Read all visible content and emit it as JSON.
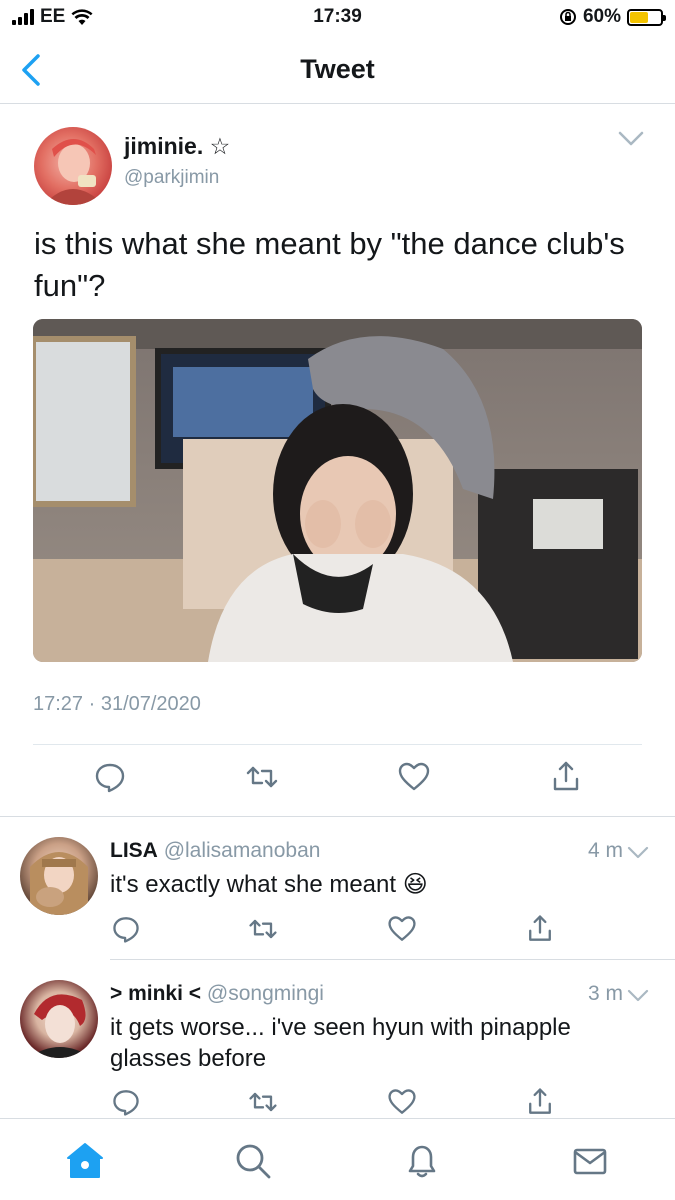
{
  "status_bar": {
    "carrier": "EE",
    "time": "17:39",
    "battery_percent": "60%",
    "battery_level": 0.6,
    "battery_color": "#f3c300"
  },
  "nav": {
    "title": "Tweet",
    "back_icon": "chevron-left-icon",
    "accent_color": "#1da1f2"
  },
  "tweet": {
    "author_name": "jiminie.",
    "author_badge": "☆",
    "author_handle": "@parkjimin",
    "text": "is this what she meant by \"the dance club's fun\"?",
    "timestamp": "17:27 · 31/07/2020",
    "actions": [
      "reply-icon",
      "retweet-icon",
      "like-icon",
      "share-icon"
    ]
  },
  "replies": [
    {
      "name": "LISA",
      "handle": "@lalisamanoban",
      "time": "4 m",
      "text": "it's exactly what she meant 😆"
    },
    {
      "name": "> minki <",
      "handle": "@songmingi",
      "time": "3 m",
      "text": "it gets worse... i've seen hyun with pinapple glasses before"
    }
  ],
  "tab_bar": {
    "items": [
      "home-icon",
      "search-icon",
      "notifications-icon",
      "messages-icon"
    ],
    "active": "home-icon"
  }
}
